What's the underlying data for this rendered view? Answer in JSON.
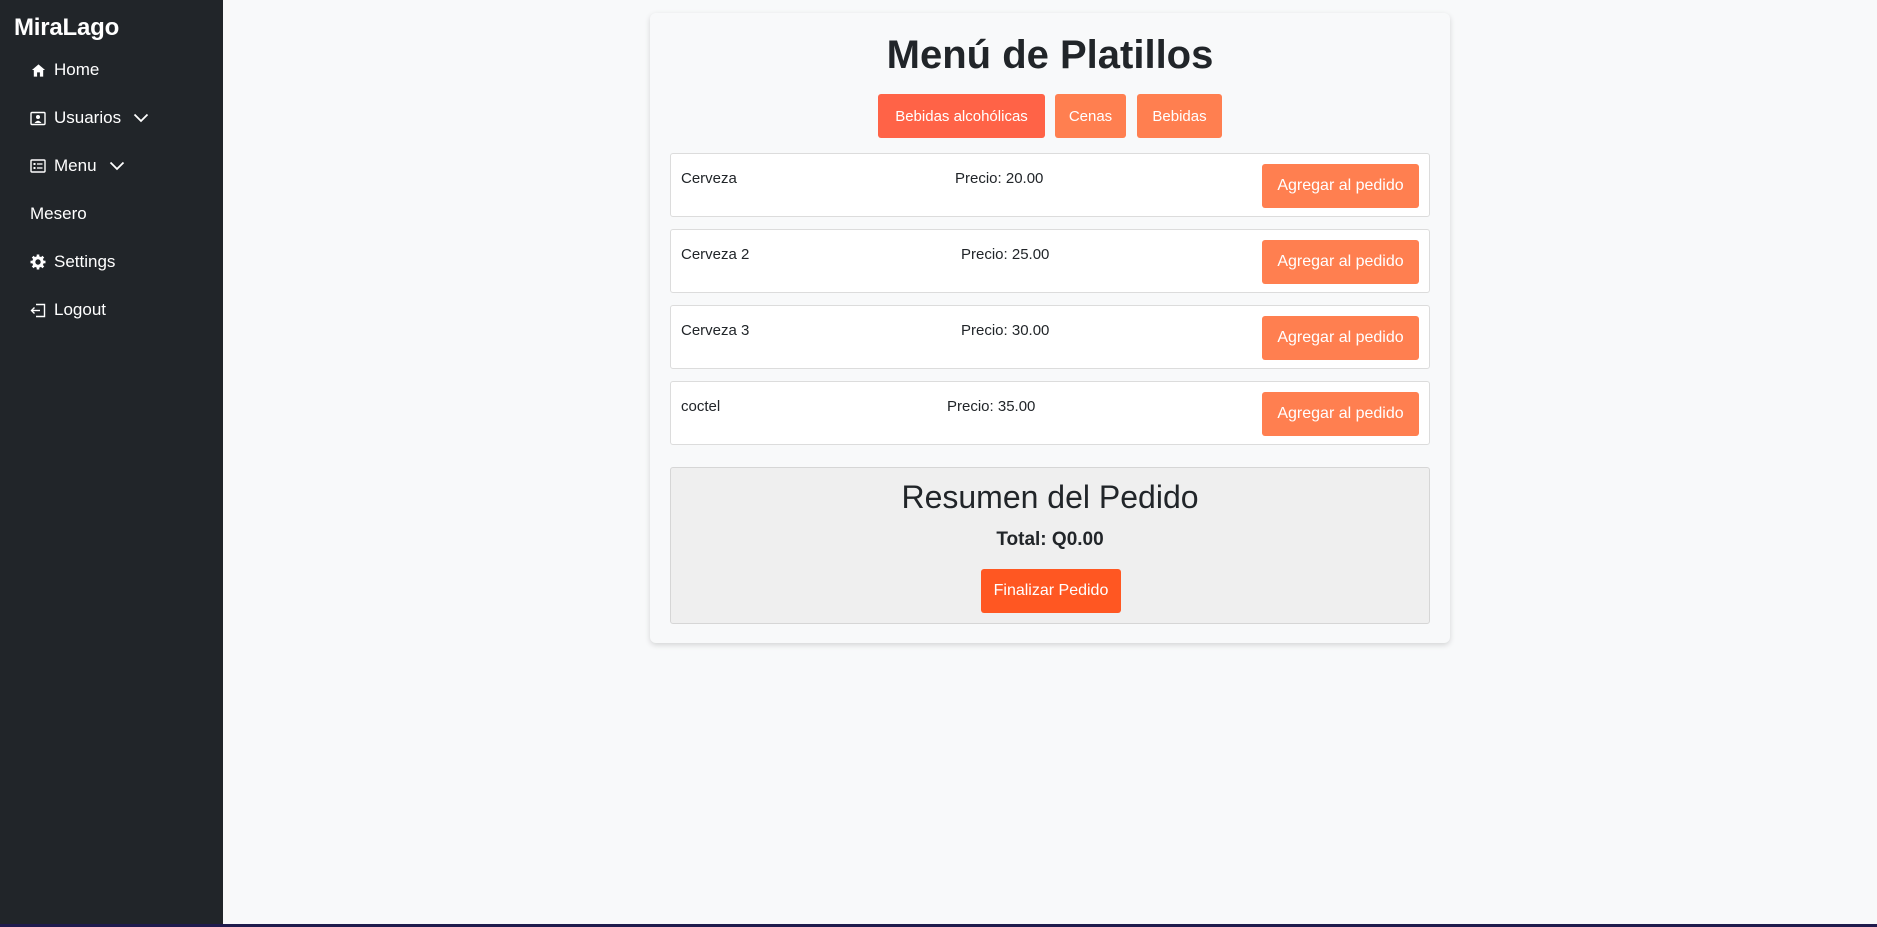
{
  "sidebar": {
    "brand": "MiraLago",
    "items": [
      {
        "label": "Home",
        "icon": "home-icon"
      },
      {
        "label": "Usuarios",
        "icon": "user-card-icon",
        "has_dropdown": true
      },
      {
        "label": "Menu",
        "icon": "list-card-icon",
        "has_dropdown": true
      },
      {
        "label": "Mesero",
        "icon": ""
      },
      {
        "label": "Settings",
        "icon": "gear-icon"
      },
      {
        "label": "Logout",
        "icon": "logout-icon"
      }
    ]
  },
  "main": {
    "title": "Menú de Platillos",
    "categories": [
      {
        "label": "Bebidas alcohólicas",
        "active": true
      },
      {
        "label": "Cenas",
        "active": false
      },
      {
        "label": "Bebidas",
        "active": false
      }
    ],
    "items": [
      {
        "name": "Cerveza",
        "price": "Precio: 20.00",
        "button": "Agregar al pedido"
      },
      {
        "name": "Cerveza 2",
        "price": "Precio: 25.00",
        "button": "Agregar al pedido"
      },
      {
        "name": "Cerveza 3",
        "price": "Precio: 30.00",
        "button": "Agregar al pedido"
      },
      {
        "name": "coctel",
        "price": "Precio: 35.00",
        "button": "Agregar al pedido"
      }
    ],
    "summary": {
      "title": "Resumen del Pedido",
      "total": "Total: Q0.00",
      "finish_button": "Finalizar Pedido"
    }
  },
  "colors": {
    "sidebar_bg": "#212529",
    "accent": "#ff7f50",
    "active_category": "#ff6347",
    "finish": "#ff5722"
  }
}
